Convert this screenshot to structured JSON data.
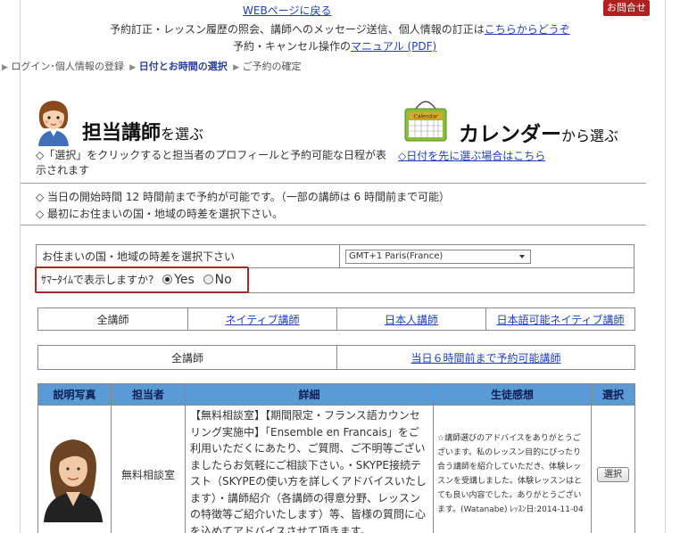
{
  "header": {
    "contact_label": "お問合せ",
    "back_link": "WEBページに戻る",
    "line2_text": "予約訂正・レッスン履歴の照会、講師へのメッセージ送信、個人情報の訂正は",
    "line2_link": "こちらからどうぞ",
    "line3_text": "予約・キャンセル操作の",
    "line3_link": "マニュアル (PDF)"
  },
  "steps": {
    "step1": "ログイン･個人情報の登録",
    "step2": "日付とお時間の選択",
    "step3": "ご予約の確定"
  },
  "choose": {
    "teacher_main": "担当講師",
    "teacher_suffix": "を選ぶ",
    "calendar_main": "カレンダー",
    "calendar_suffix": "から選ぶ",
    "calendar_icon_text": "Calendar",
    "teacher_desc": "◇「選択」をクリックすると担当者のプロフィールと予約可能な日程が表示されます",
    "calendar_link": "◇日付を先に選ぶ場合はこちら"
  },
  "notes": {
    "note1": "◇ 当日の開始時間 12 時間前まで予約が可能です。（一部の講師は 6 時間前まで可能）",
    "note2": "◇ 最初にお住まいの国・地域の時差を選択下さい。"
  },
  "timezone": {
    "label": "お住まいの国・地域の時差を選択下さい",
    "selected": "GMT+1 Paris(France)",
    "summer_label": "ｻﾏｰﾀｲﾑで表示しますか?",
    "yes": "Yes",
    "no": "No",
    "yes_selected": true
  },
  "categories": {
    "all": "全講師",
    "native": "ネイティブ講師",
    "japanese": "日本人講師",
    "japanese_capable_native": "日本語可能ネイティブ講師"
  },
  "filter": {
    "all": "全講師",
    "six_hours": "当日６時間前まで予約可能講師"
  },
  "table": {
    "headers": [
      "説明写真",
      "担当者",
      "詳細",
      "生徒感想",
      "選択"
    ],
    "rows": [
      {
        "name": "無料相談室",
        "detail": "【無料相談室】【期間限定・フランス語カウンセリング実施中】「Ensemble en Francais」をご利用いただくにあたり、ご質問、ご不明等ございましたらお気軽にご相談下さい。・SKYPE接続テスト（SKYPEの使い方を詳しくアドバイスいたします）・講師紹介（各講師の得意分野、レッスンの特徴等ご紹介いたします）等、皆様の質問に心を込めてアドバイスさせて頂きます。",
        "review": "☆講師選びのアドバイスをありがとうございます。私のレッスン目的にぴったり合う講師を紹介していただき、体験レッスンを受講しました。体験レッスンはとても良い内容でした。ありがとうございます。(Watanabe) ﾚｯｽﾝ日:2014-11-04",
        "select_label": "選択"
      }
    ]
  }
}
